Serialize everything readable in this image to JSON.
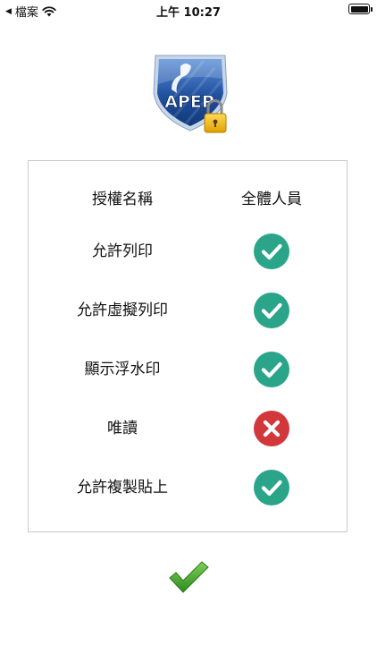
{
  "status_bar": {
    "carrier": "檔案",
    "time": "上午 10:27"
  },
  "logo": {
    "text": "APEP"
  },
  "permissions": {
    "header": {
      "name": "授權名稱",
      "scope": "全體人員"
    },
    "items": [
      {
        "label": "允許列印",
        "allowed": true
      },
      {
        "label": "允許虛擬列印",
        "allowed": true
      },
      {
        "label": "顯示浮水印",
        "allowed": true
      },
      {
        "label": "唯讀",
        "allowed": false
      },
      {
        "label": "允許複製貼上",
        "allowed": true
      }
    ]
  },
  "colors": {
    "allowed": "#2aa58a",
    "denied": "#d2383b",
    "confirm": "#3d9b2a",
    "border": "#c9c9c9"
  },
  "icons": {
    "allowed": "check-circle-icon",
    "denied": "x-circle-icon",
    "confirm": "checkmark-icon",
    "lock": "padlock-icon"
  }
}
